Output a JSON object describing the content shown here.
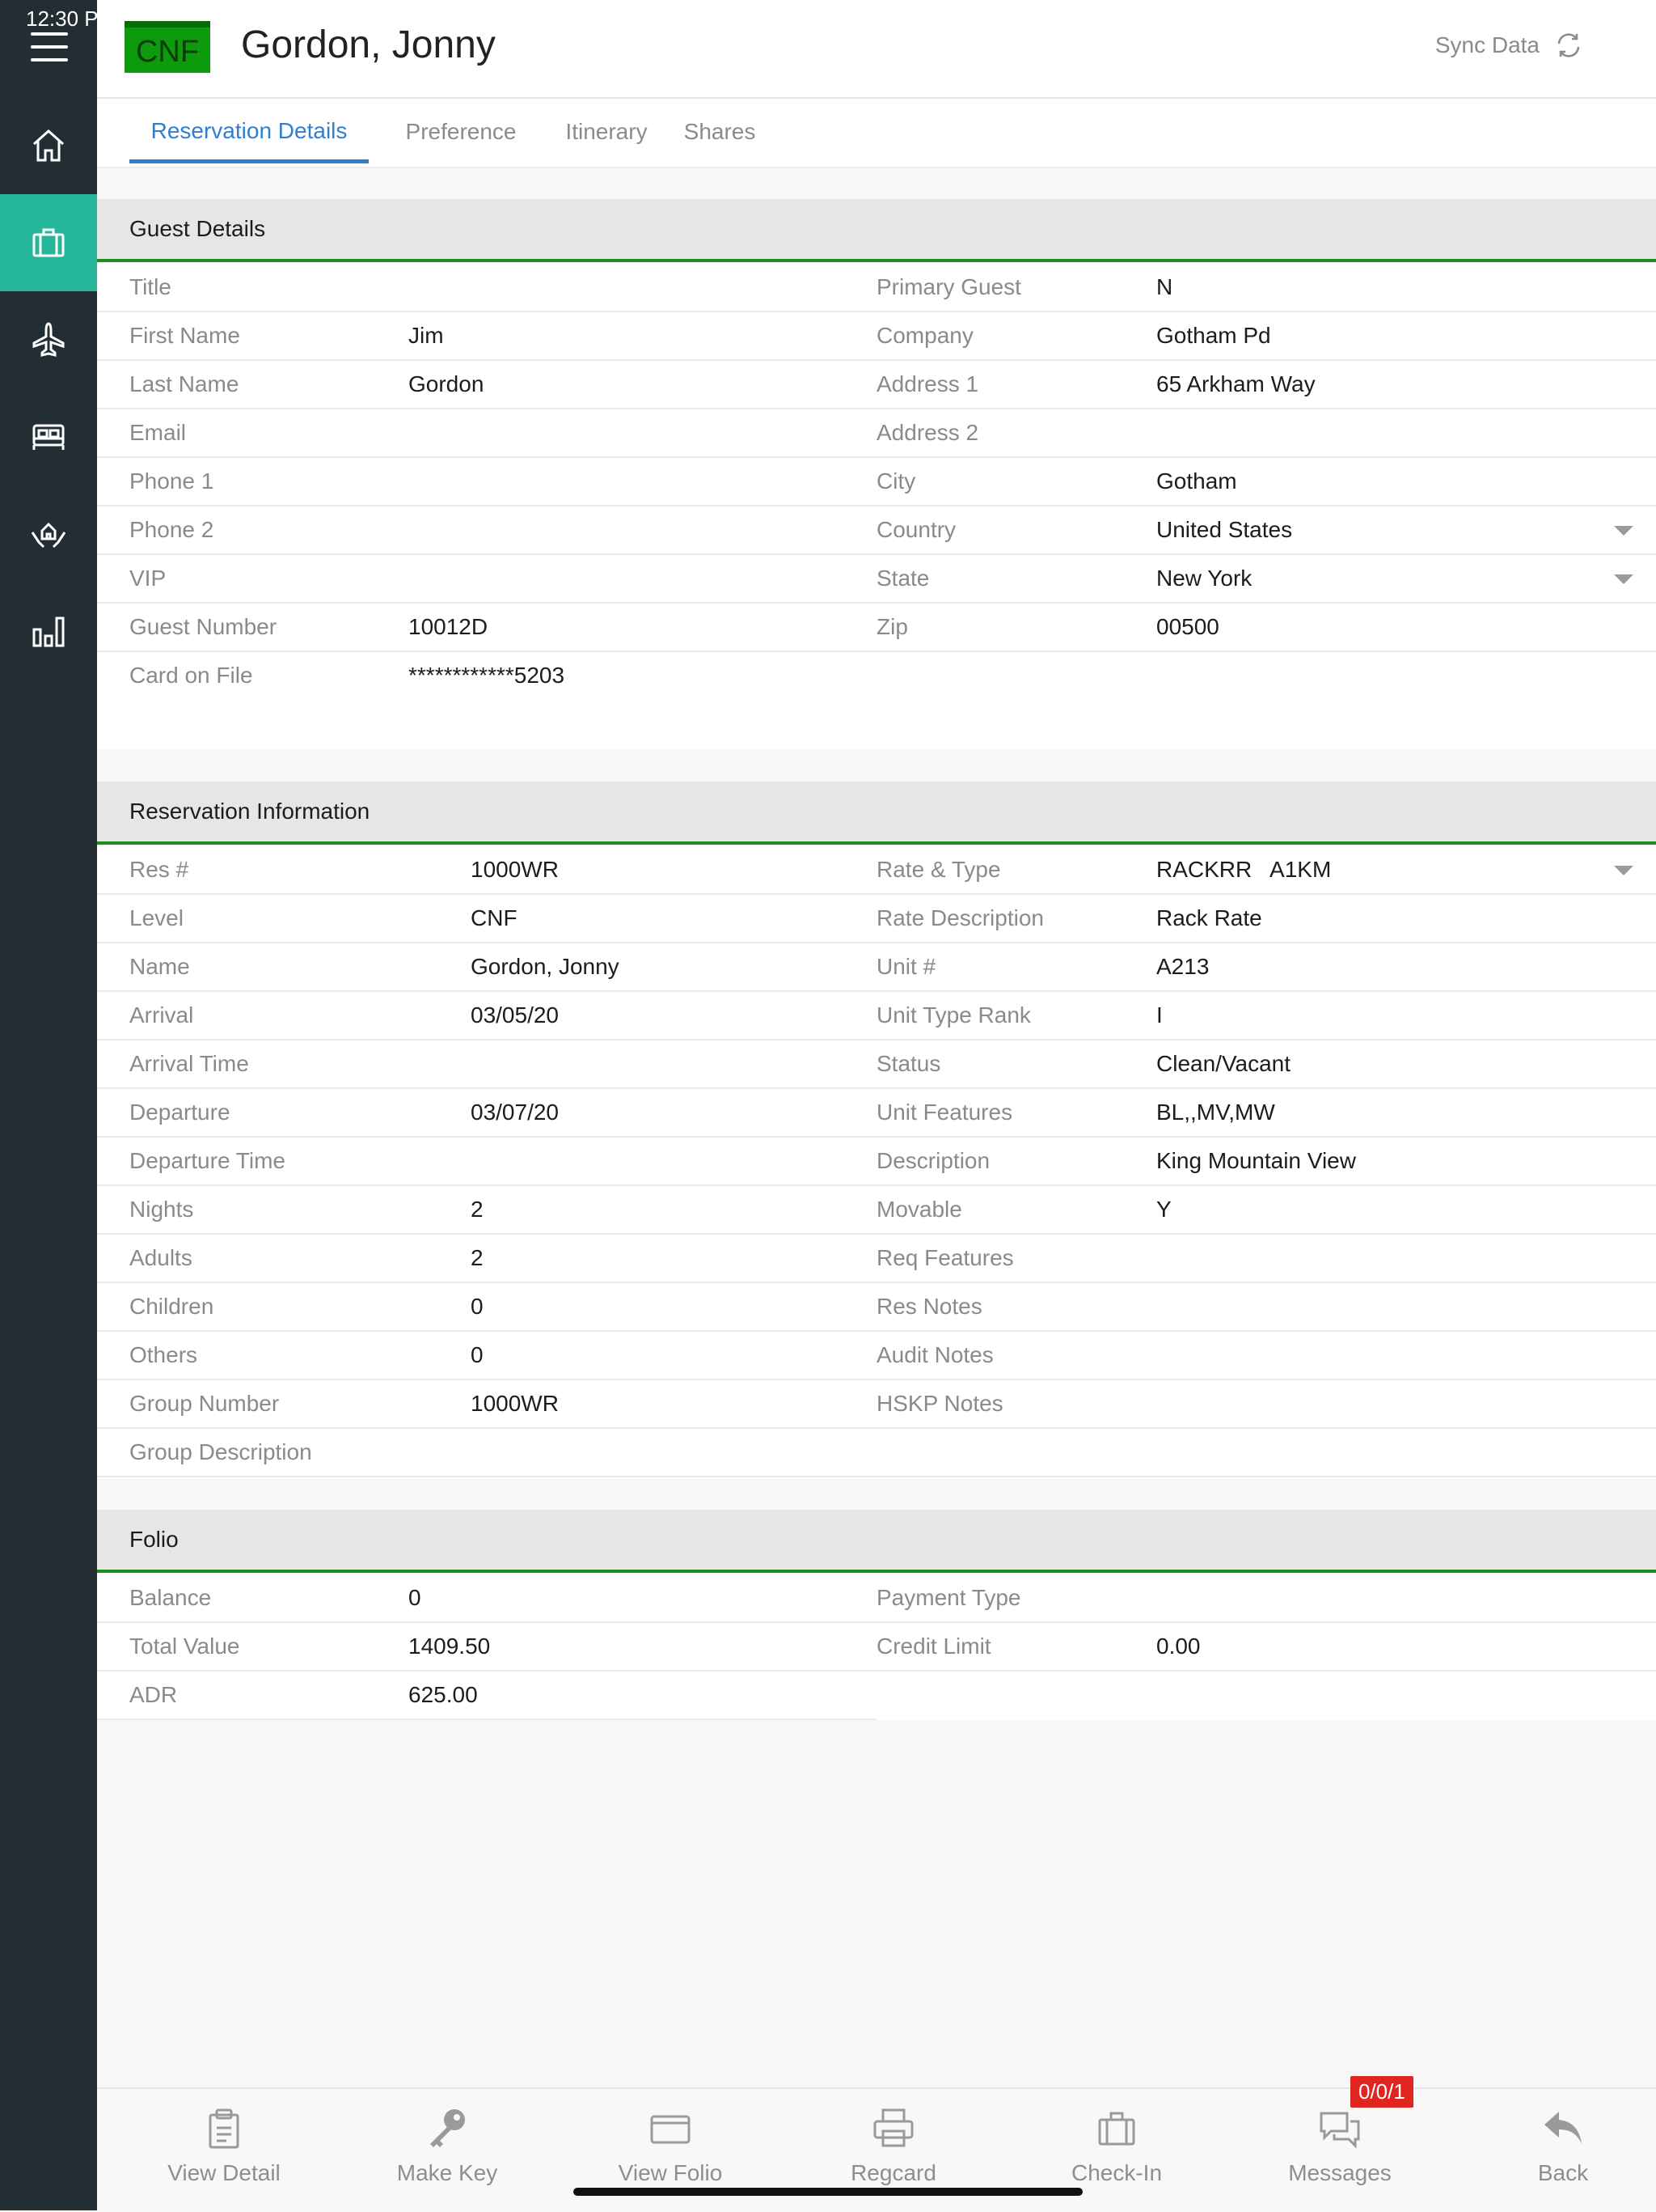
{
  "status_bar": {
    "time": "12:30 P"
  },
  "header": {
    "level_badge": "CNF",
    "guest_name": "Gordon, Jonny",
    "sync_label": "Sync Data"
  },
  "tabs": [
    {
      "label": "Reservation Details",
      "active": true
    },
    {
      "label": "Preference",
      "active": false
    },
    {
      "label": "Itinerary",
      "active": false
    },
    {
      "label": "Shares",
      "active": false
    }
  ],
  "guest_details": {
    "title": "Guest Details",
    "left": [
      {
        "label": "Title",
        "value": ""
      },
      {
        "label": "First Name",
        "value": "Jim"
      },
      {
        "label": "Last Name",
        "value": "Gordon"
      },
      {
        "label": "Email",
        "value": ""
      },
      {
        "label": "Phone 1",
        "value": ""
      },
      {
        "label": "Phone 2",
        "value": ""
      },
      {
        "label": "VIP",
        "value": ""
      },
      {
        "label": "Guest Number",
        "value": "10012D"
      },
      {
        "label": "Card on File",
        "value": "************5203"
      }
    ],
    "right": [
      {
        "label": "Primary Guest",
        "value": "N"
      },
      {
        "label": "Company",
        "value": "Gotham Pd"
      },
      {
        "label": "Address 1",
        "value": "65 Arkham Way"
      },
      {
        "label": "Address 2",
        "value": ""
      },
      {
        "label": "City",
        "value": "Gotham"
      },
      {
        "label": "Country",
        "value": "United States"
      },
      {
        "label": "State",
        "value": "New York"
      },
      {
        "label": "Zip",
        "value": "00500"
      }
    ]
  },
  "reservation_info": {
    "title": "Reservation Information",
    "left": [
      {
        "label": "Res #",
        "value": "1000WR"
      },
      {
        "label": "Level",
        "value": "CNF"
      },
      {
        "label": "Name",
        "value": "Gordon, Jonny"
      },
      {
        "label": "Arrival",
        "value": "03/05/20"
      },
      {
        "label": "Arrival Time",
        "value": ""
      },
      {
        "label": "Departure",
        "value": "03/07/20"
      },
      {
        "label": "Departure Time",
        "value": ""
      },
      {
        "label": "Nights",
        "value": "2"
      },
      {
        "label": "Adults",
        "value": "2"
      },
      {
        "label": "Children",
        "value": "0"
      },
      {
        "label": "Others",
        "value": "0"
      },
      {
        "label": "Group Number",
        "value": "1000WR"
      },
      {
        "label": "Group Description",
        "value": ""
      }
    ],
    "right": [
      {
        "label": "Rate & Type",
        "value": "RACKRR   A1KM"
      },
      {
        "label": "Rate Description",
        "value": "Rack Rate"
      },
      {
        "label": "Unit #",
        "value": "A213"
      },
      {
        "label": "Unit Type Rank",
        "value": "I"
      },
      {
        "label": "Status",
        "value": "Clean/Vacant"
      },
      {
        "label": "Unit Features",
        "value": "BL,,MV,MW"
      },
      {
        "label": "Description",
        "value": "King Mountain View"
      },
      {
        "label": "Movable",
        "value": "Y"
      },
      {
        "label": "Req Features",
        "value": ""
      },
      {
        "label": "Res Notes",
        "value": ""
      },
      {
        "label": "Audit Notes",
        "value": ""
      },
      {
        "label": "HSKP Notes",
        "value": ""
      }
    ]
  },
  "folio": {
    "title": "Folio",
    "left": [
      {
        "label": "Balance",
        "value": "0"
      },
      {
        "label": "Total Value",
        "value": "1409.50"
      },
      {
        "label": "ADR",
        "value": "625.00"
      }
    ],
    "right": [
      {
        "label": "Payment Type",
        "value": ""
      },
      {
        "label": "Credit Limit",
        "value": "0.00"
      }
    ]
  },
  "toolbar": {
    "view_detail": "View Detail",
    "make_key": "Make Key",
    "view_folio": "View Folio",
    "regcard": "Regcard",
    "check_in": "Check-In",
    "messages": "Messages",
    "messages_badge": "0/0/1",
    "back": "Back"
  },
  "colors": {
    "sidebar": "#232d34",
    "sidebar_active": "#26b79a",
    "tab_active": "#2f7fd1",
    "section_rule": "#1f8a1f",
    "badge_red": "#e0251f"
  }
}
